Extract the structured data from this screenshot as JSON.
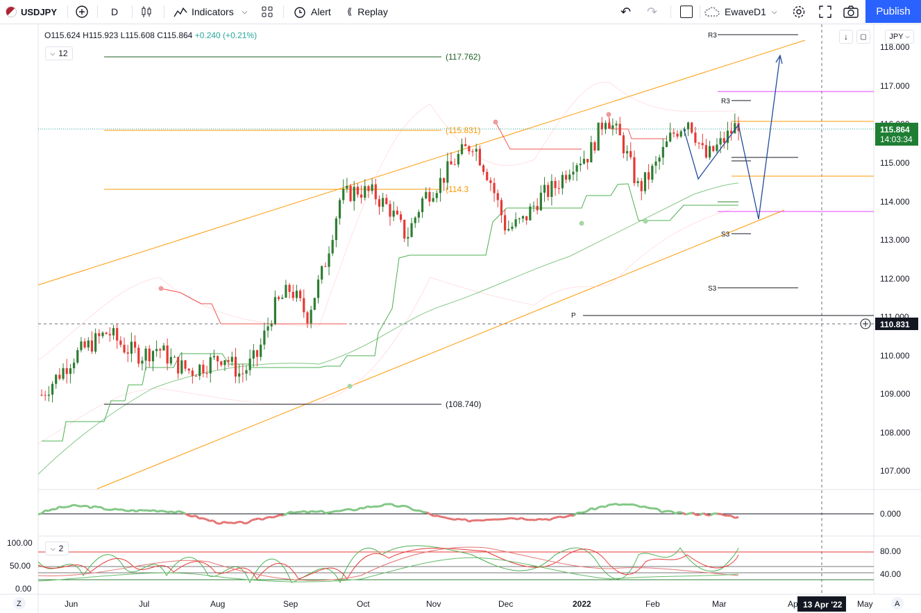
{
  "toolbar": {
    "symbol": "USDJPY",
    "interval": "D",
    "indicators_label": "Indicators",
    "alert_label": "Alert",
    "replay_label": "Replay",
    "layout_name": "EwaveD1",
    "publish_label": "Publish"
  },
  "legend": {
    "open": "O115.624",
    "high": "H115.923",
    "low": "L115.608",
    "close": "C115.864",
    "change": "+0.240 (+0.21%)",
    "indicator_count": "12"
  },
  "sub_legend": {
    "indicator_count": "2"
  },
  "price_axis": {
    "currency": "JPY",
    "ticks": [
      "118.000",
      "117.000",
      "116.000",
      "115.000",
      "114.000",
      "113.000",
      "112.000",
      "111.000",
      "110.000",
      "109.000",
      "108.000",
      "107.000"
    ],
    "last_price": "115.864",
    "countdown": "14:03:34",
    "crosshair_price": "110.831"
  },
  "oscillator_axis": {
    "ticks": [
      "0.000"
    ]
  },
  "stoch_axis": {
    "left_ticks": [
      "100.00",
      "50.00",
      "0.00"
    ],
    "right_ticks": [
      "80.00",
      "40.00"
    ]
  },
  "time_axis": {
    "labels": [
      "Jun",
      "Jul",
      "Aug",
      "Sep",
      "Oct",
      "Nov",
      "Dec",
      "2022",
      "Feb",
      "Mar",
      "Apr",
      "May"
    ],
    "crosshair_date": "13 Apr '22",
    "left_button": "Z",
    "right_button": "A"
  },
  "annotations": {
    "level_117": "(117.762)",
    "level_115": "(115.831)",
    "level_114": "(114.3",
    "level_108": "(108.740)",
    "pivot_r3_top": "R3",
    "pivot_r3": "R3",
    "pivot_s3": "S3",
    "pivot_s3_low": "S3",
    "pivot_p": "P"
  },
  "colors": {
    "up": "#26a69a",
    "candle_up": "#2e7d32",
    "candle_down": "#e53935",
    "accent": "#2962ff",
    "channel": "#ff9800",
    "pivot_magenta": "#e040fb"
  },
  "chart_data": {
    "type": "candlestick",
    "symbol": "USDJPY",
    "timeframe": "D",
    "ylim": [
      106.6,
      118.4
    ],
    "x_labels": [
      "Jun",
      "Jul",
      "Aug",
      "Sep",
      "Oct",
      "Nov",
      "Dec",
      "2022",
      "Feb",
      "Mar",
      "Apr",
      "May"
    ],
    "close_path": [
      109.0,
      109.5,
      110.0,
      110.3,
      110.6,
      110.2,
      110.0,
      110.2,
      109.8,
      109.6,
      109.8,
      110.0,
      109.5,
      110.0,
      111.2,
      111.7,
      111.0,
      112.2,
      114.0,
      114.2,
      114.1,
      113.7,
      113.0,
      114.0,
      114.4,
      115.0,
      115.4,
      114.5,
      113.2,
      113.4,
      114.0,
      114.3,
      114.9,
      115.1,
      116.1,
      115.4,
      114.2,
      114.8,
      115.6,
      116.0,
      115.0,
      115.4,
      115.9
    ],
    "horizontal_levels": [
      117.762,
      115.831,
      114.3,
      108.74
    ],
    "current_price": 115.864
  }
}
